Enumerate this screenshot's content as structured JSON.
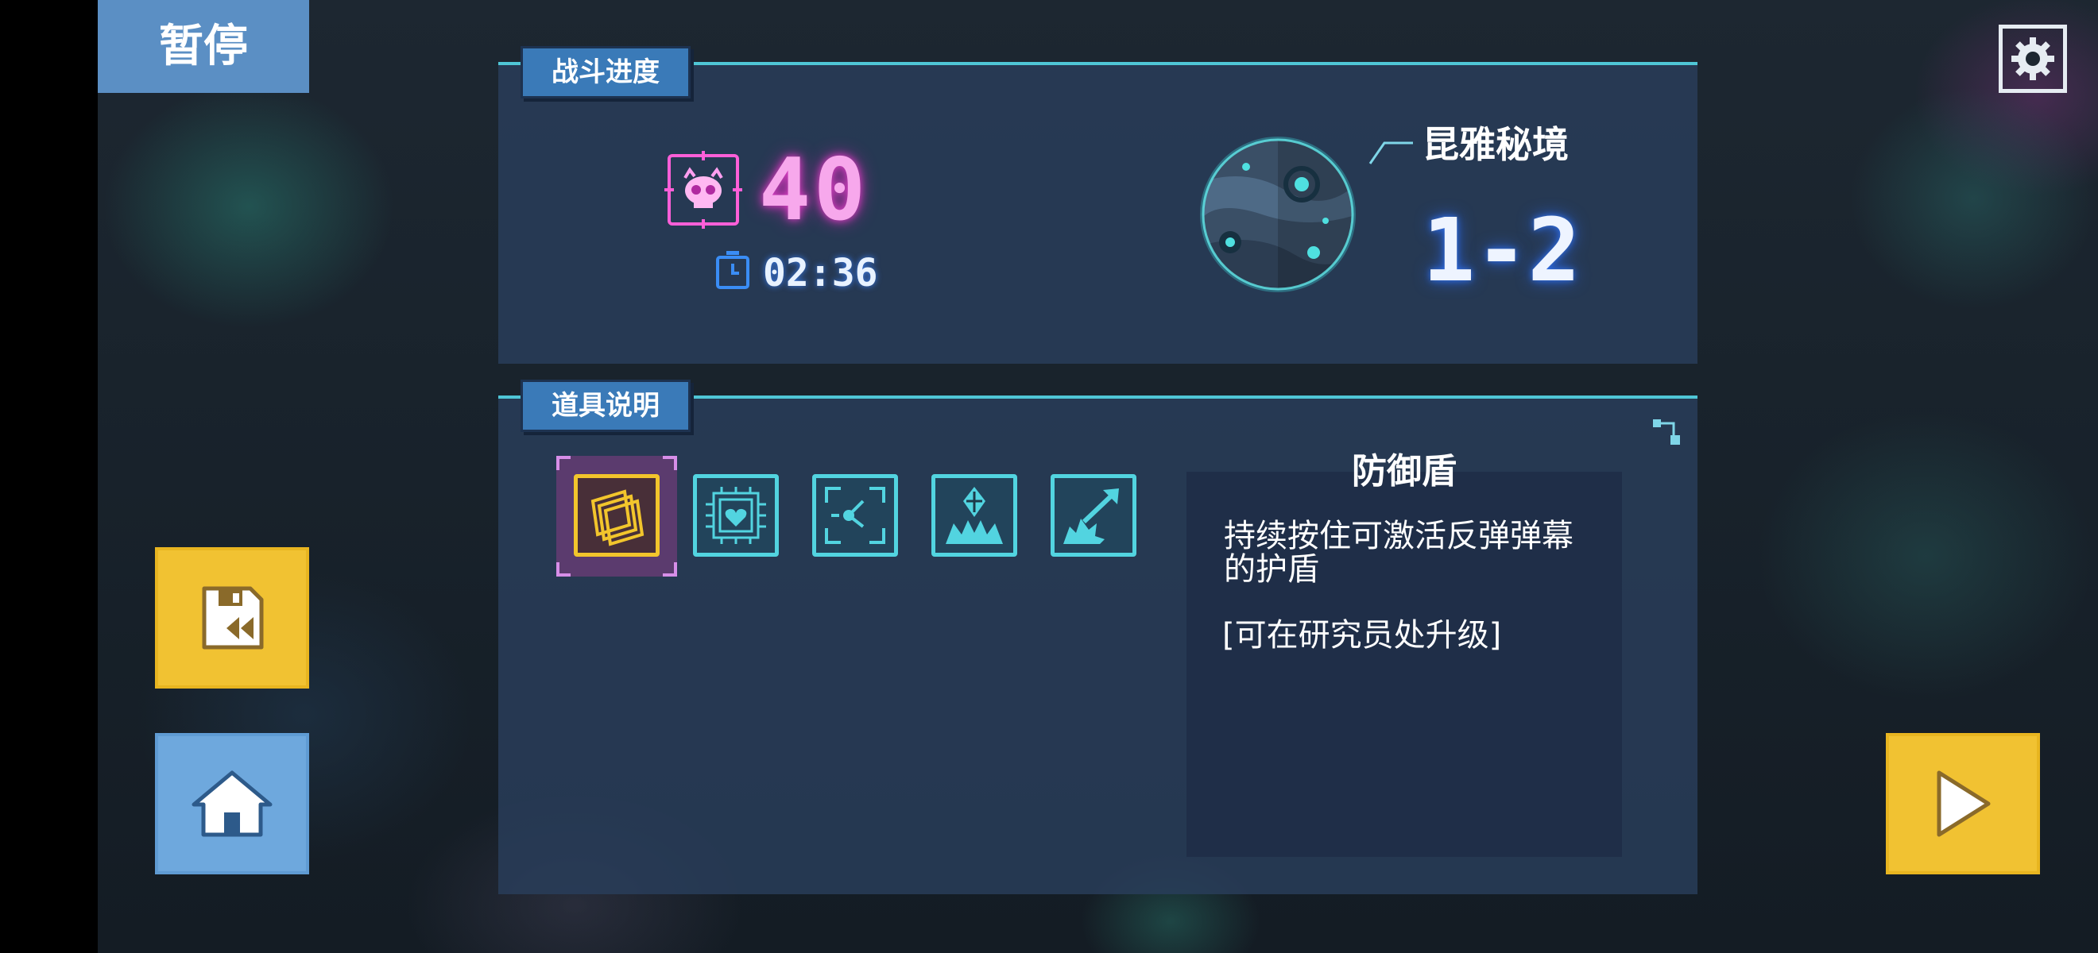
{
  "pause": {
    "title": "暂停"
  },
  "battle_progress": {
    "section_label": "战斗进度",
    "kill_count": "40",
    "timer": "02:36",
    "stage_name": "昆雅秘境",
    "stage_number": "1-2"
  },
  "items": {
    "section_label": "道具说明",
    "selected_item": {
      "name": "防御盾",
      "description": "持续按住可激活反弹弹幕的护盾",
      "note": "[可在研究员处升级]"
    },
    "slots": [
      {
        "icon": "shield-cards-icon",
        "selected": true
      },
      {
        "icon": "heart-chip-icon",
        "selected": false
      },
      {
        "icon": "target-node-icon",
        "selected": false
      },
      {
        "icon": "crystal-burst-icon",
        "selected": false
      },
      {
        "icon": "arrow-burst-icon",
        "selected": false
      }
    ]
  },
  "colors": {
    "accent_cyan": "#4fc6d6",
    "panel": "#2a3e5c",
    "tag_blue": "#3a7ab8",
    "button_yellow": "#f1c232",
    "button_blue": "#6ea8dd",
    "kill_pink": "#f7a8ec"
  },
  "buttons": {
    "settings": "gear-icon",
    "load_save": "save-rewind-icon",
    "home": "home-icon",
    "resume": "play-icon"
  }
}
